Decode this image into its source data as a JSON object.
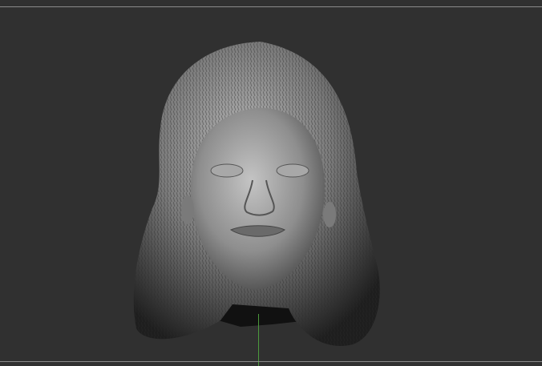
{
  "viewport": {
    "background": "#303030",
    "model": "sculpted-head",
    "axis_color": "#4c9a3c"
  }
}
